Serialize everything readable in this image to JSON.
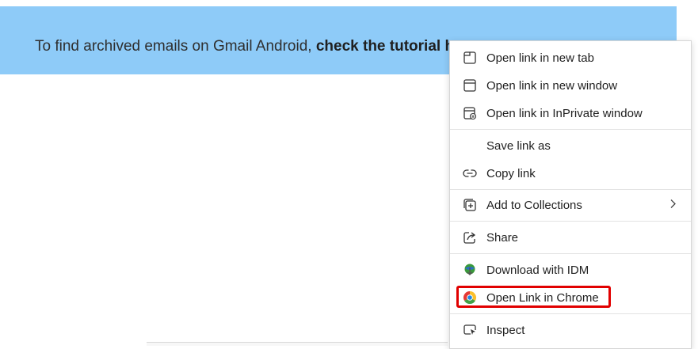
{
  "banner": {
    "text": "To find archived emails on Gmail Android, ",
    "link": "check the tutorial here."
  },
  "menu": {
    "items": [
      {
        "label": "Open link in new tab",
        "icon": "new-tab-icon"
      },
      {
        "label": "Open link in new window",
        "icon": "new-window-icon"
      },
      {
        "label": "Open link in InPrivate window",
        "icon": "inprivate-window-icon"
      },
      {
        "label": "Save link as",
        "icon": ""
      },
      {
        "label": "Copy link",
        "icon": "link-icon"
      },
      {
        "label": "Add to Collections",
        "icon": "collections-icon",
        "has_submenu": true
      },
      {
        "label": "Share",
        "icon": "share-icon"
      },
      {
        "label": "Download with IDM",
        "icon": "idm-icon"
      },
      {
        "label": "Open Link in Chrome",
        "icon": "chrome-icon",
        "highlighted": true
      },
      {
        "label": "Inspect",
        "icon": "inspect-icon"
      }
    ]
  },
  "colors": {
    "banner_bg": "#8ecbf8",
    "highlight_border": "#e10000"
  }
}
